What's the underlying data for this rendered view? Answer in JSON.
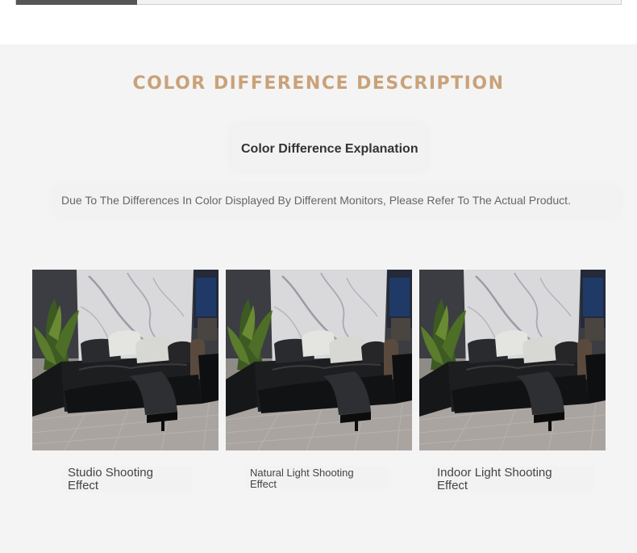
{
  "progress": {
    "value": 0.2
  },
  "section": {
    "title": "COLOR DIFFERENCE DESCRIPTION",
    "subtitle": "Color Difference Explanation",
    "description": "Due To The Differences In Color Displayed By Different Monitors, Please Refer To The Actual Product."
  },
  "cards": [
    {
      "caption_line1": "Studio Shooting",
      "caption_line2": "Effect",
      "image": "sofa-photo"
    },
    {
      "caption_line1": "Natural Light Shooting",
      "caption_line2": "Effect",
      "image": "sofa-photo"
    },
    {
      "caption_line1": "Indoor Light Shooting",
      "caption_line2": "Effect",
      "image": "sofa-photo"
    }
  ],
  "colors": {
    "title": "#c9a27a",
    "background": "#f4f4f4",
    "progress_fill": "#555555",
    "text_dark": "#333333",
    "text_muted": "#666666"
  }
}
